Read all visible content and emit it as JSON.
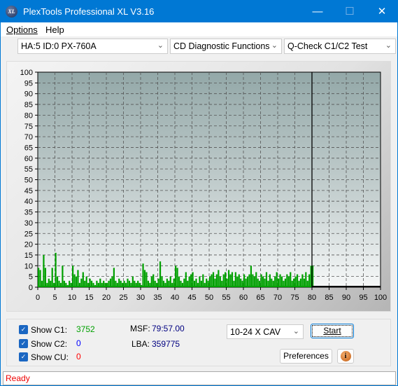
{
  "window": {
    "title": "PlexTools Professional XL V3.16",
    "logo_text": "XL"
  },
  "menu": [
    {
      "label": "Options"
    },
    {
      "label": "Help"
    }
  ],
  "toolbar": {
    "drive": "HA:5 ID:0  PX-760A",
    "function": "CD Diagnostic Functions",
    "test": "Q-Check C1/C2 Test"
  },
  "chart_data": {
    "type": "bar",
    "xlim": [
      0,
      100
    ],
    "ylim": [
      0,
      100
    ],
    "xticks": [
      "0",
      "5",
      "10",
      "15",
      "20",
      "25",
      "30",
      "35",
      "40",
      "45",
      "50",
      "55",
      "60",
      "65",
      "70",
      "75",
      "80",
      "85",
      "90",
      "95",
      "100"
    ],
    "yticks": [
      "0",
      "5",
      "10",
      "15",
      "20",
      "25",
      "30",
      "35",
      "40",
      "45",
      "50",
      "55",
      "60",
      "65",
      "70",
      "75",
      "80",
      "85",
      "90",
      "95",
      "100"
    ],
    "grid": true,
    "marker_x": 80,
    "series": [
      {
        "color": "#00a000",
        "x_step": 0.5,
        "x_start": 0,
        "values": [
          9,
          8,
          3,
          15,
          9,
          2,
          4,
          3,
          9,
          2,
          16,
          5,
          3,
          2,
          10,
          3,
          2,
          1,
          3,
          2,
          10,
          6,
          5,
          8,
          2,
          4,
          7,
          3,
          5,
          2,
          4,
          3,
          2,
          1,
          3,
          2,
          4,
          2,
          3,
          2,
          2,
          3,
          4,
          5,
          9,
          3,
          2,
          4,
          3,
          2,
          3,
          2,
          4,
          3,
          2,
          5,
          3,
          2,
          3,
          2,
          1,
          11,
          8,
          7,
          3,
          2,
          5,
          6,
          3,
          2,
          4,
          12,
          5,
          3,
          2,
          4,
          3,
          5,
          2,
          4,
          10,
          9,
          5,
          3,
          2,
          4,
          7,
          3,
          5,
          6,
          7,
          3,
          4,
          2,
          5,
          3,
          6,
          2,
          4,
          3,
          5,
          6,
          7,
          4,
          6,
          8,
          5,
          3,
          6,
          7,
          4,
          8,
          6,
          7,
          3,
          7,
          5,
          6,
          4,
          3,
          6,
          4,
          5,
          6,
          10,
          6,
          5,
          7,
          4,
          3,
          6,
          5,
          4,
          7,
          3,
          6,
          4,
          3,
          5,
          7,
          4,
          6,
          5,
          3,
          4,
          6,
          5,
          7,
          3,
          4,
          5,
          6,
          3,
          4,
          6,
          4,
          7,
          3,
          6,
          10,
          10
        ]
      }
    ]
  },
  "stats": {
    "c1_label": "Show C1:",
    "c1_value": "3752",
    "c1_color": "#00a000",
    "c2_label": "Show C2:",
    "c2_value": "0",
    "c2_color": "#0000ff",
    "cu_label": "Show CU:",
    "cu_value": "0",
    "cu_color": "#ff0000",
    "msf_label": "MSF:",
    "msf_value": "79:57.00",
    "lba_label": "LBA:",
    "lba_value": "359775"
  },
  "controls": {
    "speed": "10-24 X CAV",
    "start": "Start",
    "preferences": "Preferences",
    "info_icon": "info-icon"
  },
  "status": "Ready"
}
